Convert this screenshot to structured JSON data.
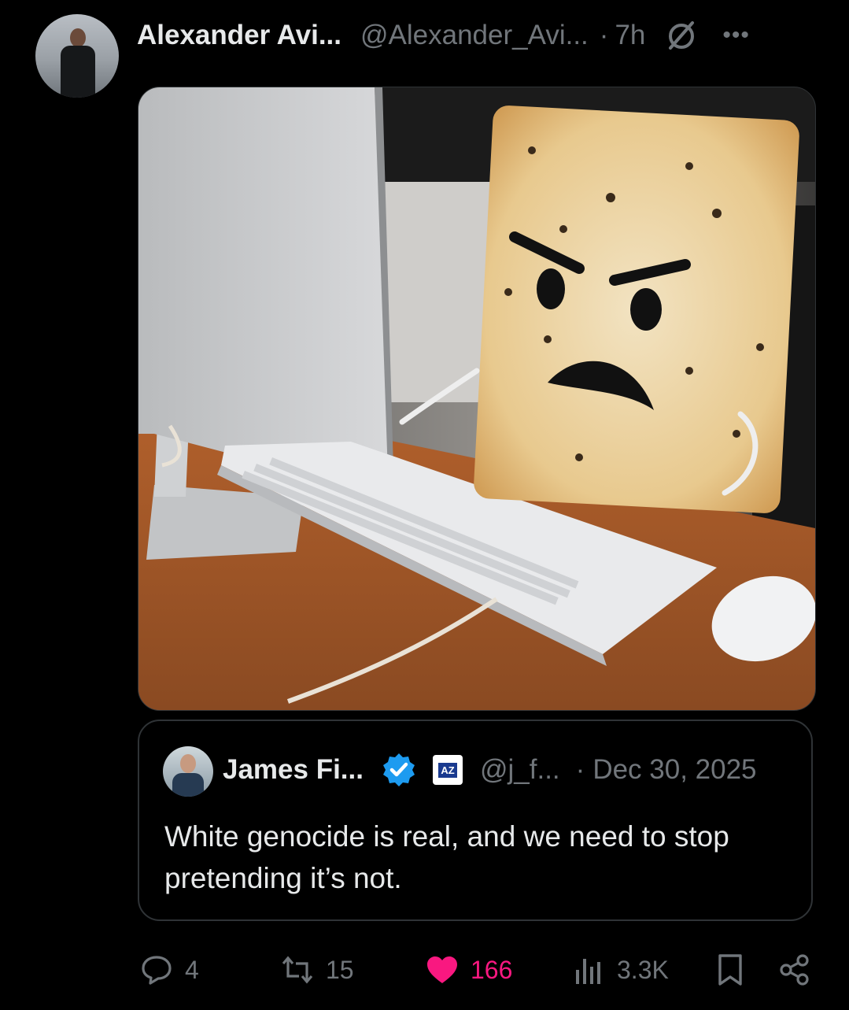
{
  "post": {
    "author_name": "Alexander Avi...",
    "author_handle": "@Alexander_Avi...",
    "separator": "·",
    "time": "7h",
    "more": "•••"
  },
  "quote": {
    "author_name": "James Fi...",
    "org_badge": "AZ",
    "author_handle": "@j_f...",
    "separator": "·",
    "date": "Dec 30, 2025",
    "text": "White genocide is real, and we need to stop pretending it’s not."
  },
  "actions": {
    "replies": "4",
    "reposts": "15",
    "likes": "166",
    "views": "3.3K"
  },
  "colors": {
    "like": "#f91880",
    "verified": "#1d9bf0",
    "muted": "#71767b",
    "border": "#2f3336"
  },
  "icons": [
    "grok-icon",
    "more-icon",
    "verified-icon",
    "reply-icon",
    "repost-icon",
    "like-icon",
    "views-icon",
    "bookmark-icon",
    "share-icon"
  ]
}
